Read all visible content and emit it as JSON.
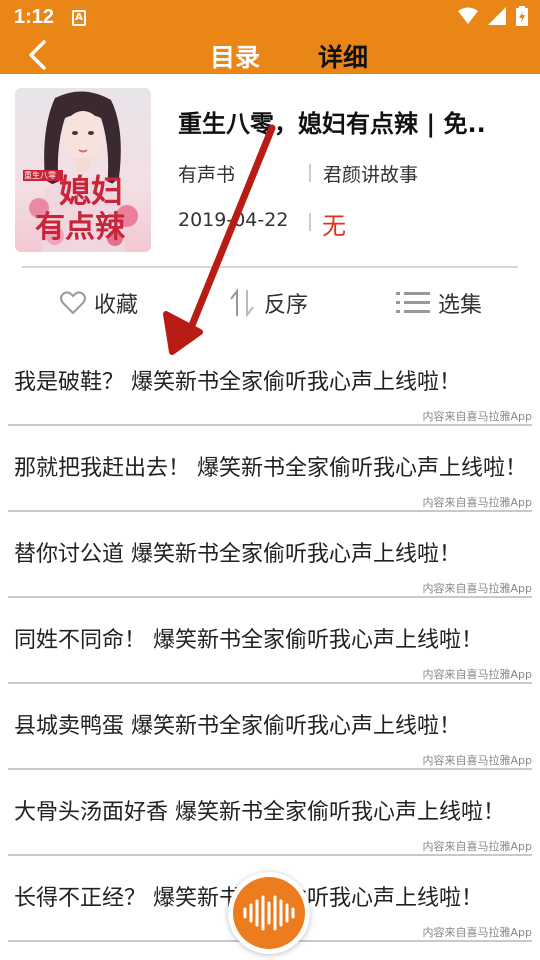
{
  "status_bar": {
    "time": "1:12",
    "app_icon": "A"
  },
  "nav": {
    "tabs": [
      {
        "label": "目录"
      },
      {
        "label": "详细"
      }
    ]
  },
  "book": {
    "title": "重生八零，媳妇有点辣 | 免..",
    "type": "有声书",
    "narrator": "君颜讲故事",
    "date": "2019-04-22",
    "status": "无",
    "cover": {
      "small_text": "重生八零",
      "big_text_1": "媳妇",
      "big_text_2": "有点辣"
    }
  },
  "actions": {
    "collect": "收藏",
    "reverse": "反序",
    "episodes": "选集"
  },
  "episodes": [
    {
      "title": "我是破鞋？ 爆笑新书全家偷听我心声上线啦！",
      "source": "内容来自喜马拉雅App"
    },
    {
      "title": "那就把我赶出去！ 爆笑新书全家偷听我心声上线啦！",
      "source": "内容来自喜马拉雅App"
    },
    {
      "title": "替你讨公道 爆笑新书全家偷听我心声上线啦！",
      "source": "内容来自喜马拉雅App"
    },
    {
      "title": "同姓不同命！ 爆笑新书全家偷听我心声上线啦！",
      "source": "内容来自喜马拉雅App"
    },
    {
      "title": "县城卖鸭蛋 爆笑新书全家偷听我心声上线啦！",
      "source": "内容来自喜马拉雅App"
    },
    {
      "title": "大骨头汤面好香 爆笑新书全家偷听我心声上线啦！",
      "source": "内容来自喜马拉雅App"
    },
    {
      "title": "长得不正经？ 爆笑新书全家偷听我心声上线啦！",
      "source": "内容来自喜马拉雅App"
    }
  ],
  "colors": {
    "accent": "#e98616",
    "status_red": "#e0301e",
    "arrow": "#b81c14"
  },
  "icons": [
    "back-arrow-icon",
    "wifi-icon",
    "signal-icon",
    "battery-icon",
    "heart-outline-icon",
    "sort-icon",
    "list-icon",
    "audio-wave-icon"
  ]
}
